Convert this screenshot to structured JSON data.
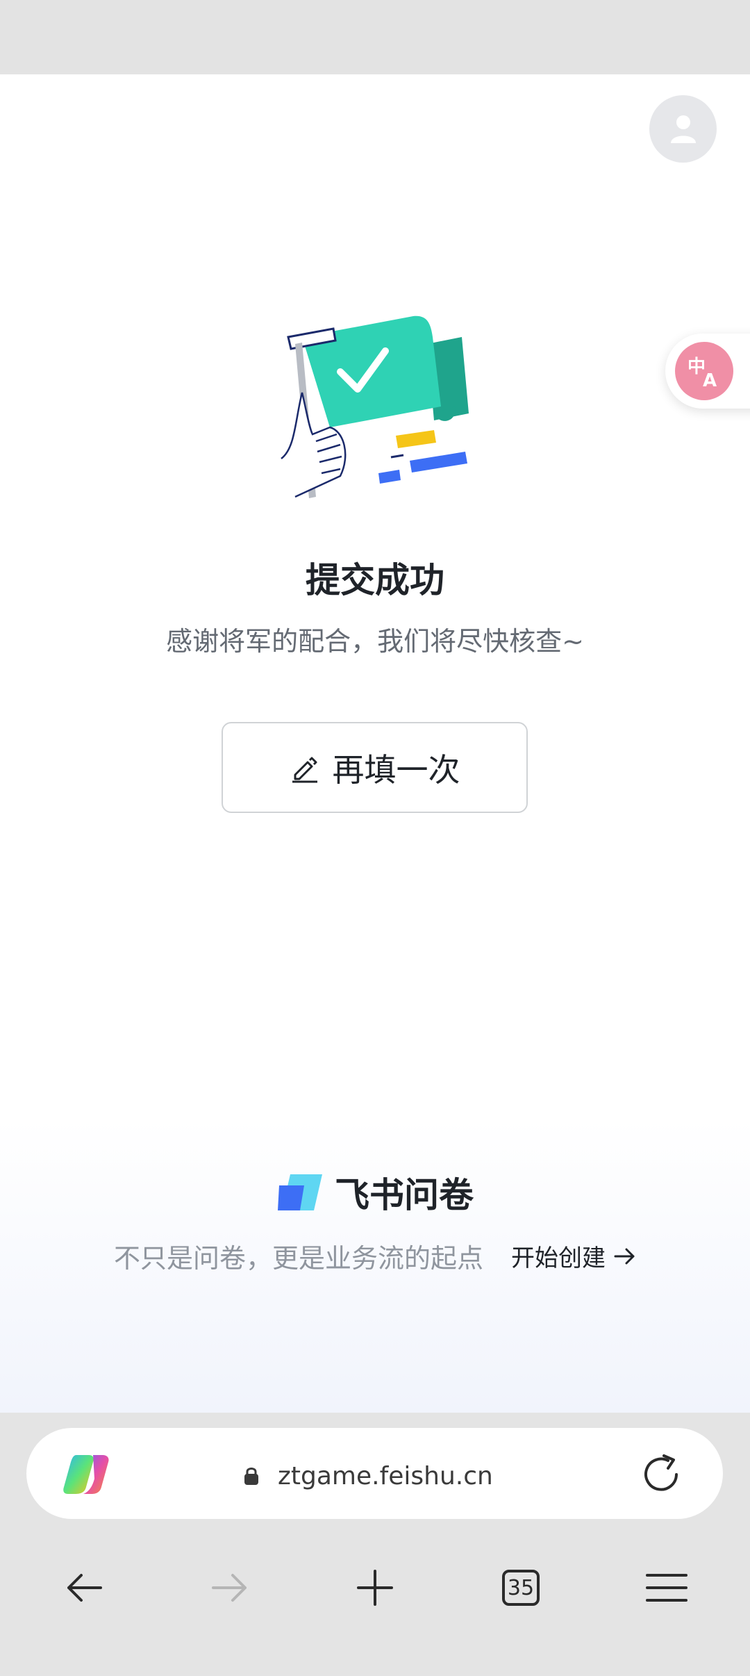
{
  "result": {
    "title": "提交成功",
    "subtitle": "感谢将军的配合，我们将尽快核查~",
    "refill_label": "再填一次"
  },
  "branding": {
    "name": "飞书问卷",
    "tagline": "不只是问卷，更是业务流的起点",
    "create_label": "开始创建"
  },
  "browser": {
    "url": "ztgame.feishu.cn",
    "tab_count": "35"
  },
  "colors": {
    "accent_green": "#2fd2b4",
    "translate_pink": "#f08fa6",
    "brand_blue": "#3370ff"
  },
  "icons": [
    "user-icon",
    "translate-icon",
    "edit-icon",
    "arrow-right-icon",
    "copilot-icon",
    "lock-icon",
    "reload-icon",
    "back-icon",
    "forward-icon",
    "plus-icon",
    "tabs-icon",
    "menu-icon"
  ]
}
